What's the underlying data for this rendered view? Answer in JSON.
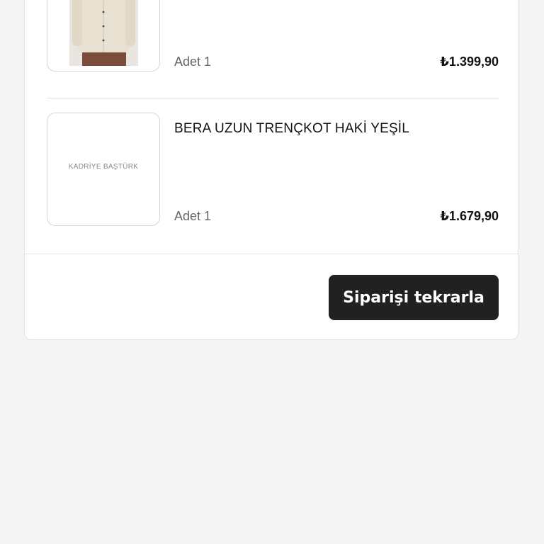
{
  "order": {
    "items": [
      {
        "title": "",
        "image": "beige-shirt-photo",
        "quantity_label": "Adet 1",
        "price": "₺1.399,90"
      },
      {
        "title": "BERA UZUN TRENÇKOT HAKİ YEŞİL",
        "image": "brand-logo-placeholder",
        "logo_text": "KADRİYE BAŞTÜRK",
        "quantity_label": "Adet 1",
        "price": "₺1.679,90"
      }
    ],
    "reorder_label": "Siparişi tekrarla"
  },
  "colors": {
    "page_bg": "#f4f4f4",
    "card_bg": "#ffffff",
    "button_bg": "#212121",
    "button_text": "#ffffff"
  }
}
